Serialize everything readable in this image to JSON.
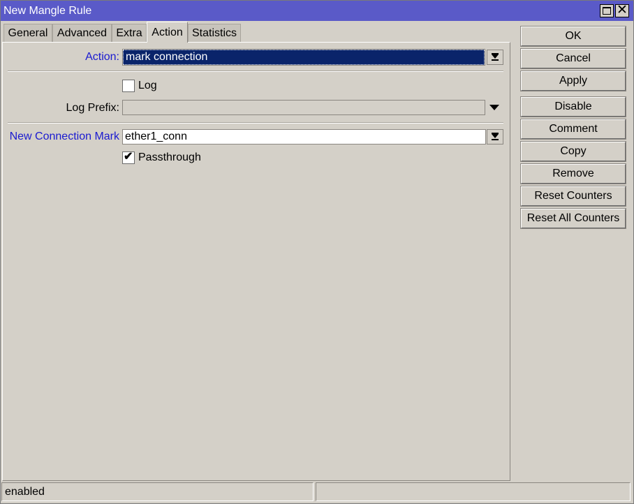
{
  "window": {
    "title": "New Mangle Rule"
  },
  "titlebar": {
    "maximize_icon": "maximize-icon",
    "close_icon": "close-icon",
    "close_glyph": "✕"
  },
  "tabs": [
    {
      "label": "General"
    },
    {
      "label": "Advanced"
    },
    {
      "label": "Extra"
    },
    {
      "label": "Action",
      "active": true
    },
    {
      "label": "Statistics"
    }
  ],
  "form": {
    "action_label": "Action:",
    "action_value": "mark connection",
    "log_label": "Log",
    "log_checked": false,
    "log_prefix_label": "Log Prefix:",
    "log_prefix_value": "",
    "new_connection_mark_label": "New Connection Mark",
    "new_connection_mark_value": "ether1_conn",
    "passthrough_label": "Passthrough",
    "passthrough_checked": true,
    "check_glyph": "✔"
  },
  "buttons": [
    "OK",
    "Cancel",
    "Apply",
    "Disable",
    "Comment",
    "Copy",
    "Remove",
    "Reset Counters",
    "Reset All Counters"
  ],
  "status": {
    "left": "enabled",
    "right": ""
  },
  "colors": {
    "titlebar": "#5a5ac8",
    "label_accent": "#1a1ad0",
    "selection": "#0a246a",
    "background": "#d4d0c8"
  }
}
